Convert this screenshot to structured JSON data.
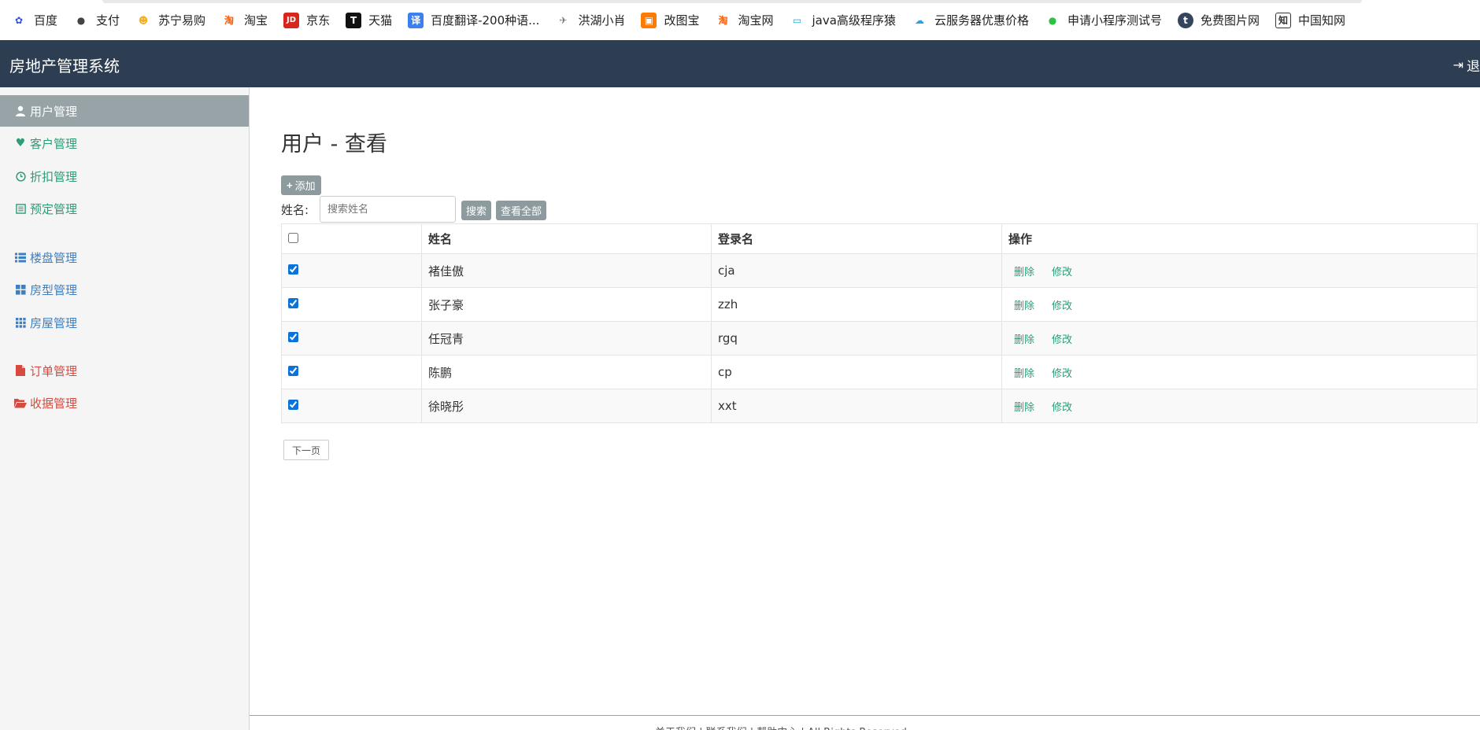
{
  "bookmarks": [
    {
      "label": "百度",
      "icon": "baidu-paw-icon",
      "color": "#2f4fd8"
    },
    {
      "label": "支付",
      "icon": "globe-icon",
      "color": "#444444"
    },
    {
      "label": "苏宁易购",
      "icon": "suning-lion-icon",
      "color": "#f2b01e"
    },
    {
      "label": "淘宝",
      "icon": "taobao-icon",
      "color": "#ff5a00"
    },
    {
      "label": "京东",
      "icon": "jd-icon",
      "color": "#d7261b"
    },
    {
      "label": "天猫",
      "icon": "tmall-icon",
      "color": "#d7001a"
    },
    {
      "label": "百度翻译-200种语...",
      "icon": "translate-icon",
      "color": "#3a80f0"
    },
    {
      "label": "洪湖小肖",
      "icon": "bird-icon",
      "color": "#777777"
    },
    {
      "label": "改图宝",
      "icon": "gaitubao-icon",
      "color": "#ff7a00"
    },
    {
      "label": "淘宝网",
      "icon": "taobao-icon",
      "color": "#ff5a00"
    },
    {
      "label": "java高级程序猿",
      "icon": "bilibili-tv-icon",
      "color": "#21a0d6"
    },
    {
      "label": "云服务器优惠价格",
      "icon": "cloud-icon",
      "color": "#2aa1e0"
    },
    {
      "label": "申请小程序测试号",
      "icon": "wechat-icon",
      "color": "#2cc242"
    },
    {
      "label": "免费图片网",
      "icon": "tumblr-icon",
      "color": "#35465c"
    },
    {
      "label": "中国知网",
      "icon": "cnki-icon",
      "color": "#333333"
    }
  ],
  "header": {
    "title": "房地产管理系统",
    "logout_label": "退"
  },
  "sidebar": {
    "items": [
      {
        "label": "用户管理",
        "icon": "user-icon"
      },
      {
        "label": "客户管理",
        "icon": "heart-icon"
      },
      {
        "label": "折扣管理",
        "icon": "clock-icon"
      },
      {
        "label": "预定管理",
        "icon": "list-box-icon"
      },
      {
        "label": "楼盘管理",
        "icon": "list-icon"
      },
      {
        "label": "房型管理",
        "icon": "grid-large-icon"
      },
      {
        "label": "房屋管理",
        "icon": "grid-small-icon"
      },
      {
        "label": "订单管理",
        "icon": "file-icon"
      },
      {
        "label": "收据管理",
        "icon": "folder-open-icon"
      }
    ]
  },
  "main": {
    "page_title": "用户 - 查看",
    "add_label": "添加",
    "search_label": "姓名:",
    "search_placeholder": "搜索姓名",
    "search_button": "搜索",
    "view_all_button": "查看全部",
    "table": {
      "headers": [
        "姓名",
        "登录名",
        "操作"
      ],
      "rows": [
        {
          "name": "褚佳傲",
          "login": "cja",
          "checked": true
        },
        {
          "name": "张子豪",
          "login": "zzh",
          "checked": true
        },
        {
          "name": "任冠青",
          "login": "rgq",
          "checked": true
        },
        {
          "name": "陈鹏",
          "login": "cp",
          "checked": true
        },
        {
          "name": "徐晓彤",
          "login": "xxt",
          "checked": true
        }
      ],
      "delete_label": "删除",
      "edit_label": "修改"
    },
    "next_page_label": "下一页"
  },
  "footer": {
    "text": "关于我们 | 联系我们 | 帮助中心 | All Rights Reserved"
  }
}
